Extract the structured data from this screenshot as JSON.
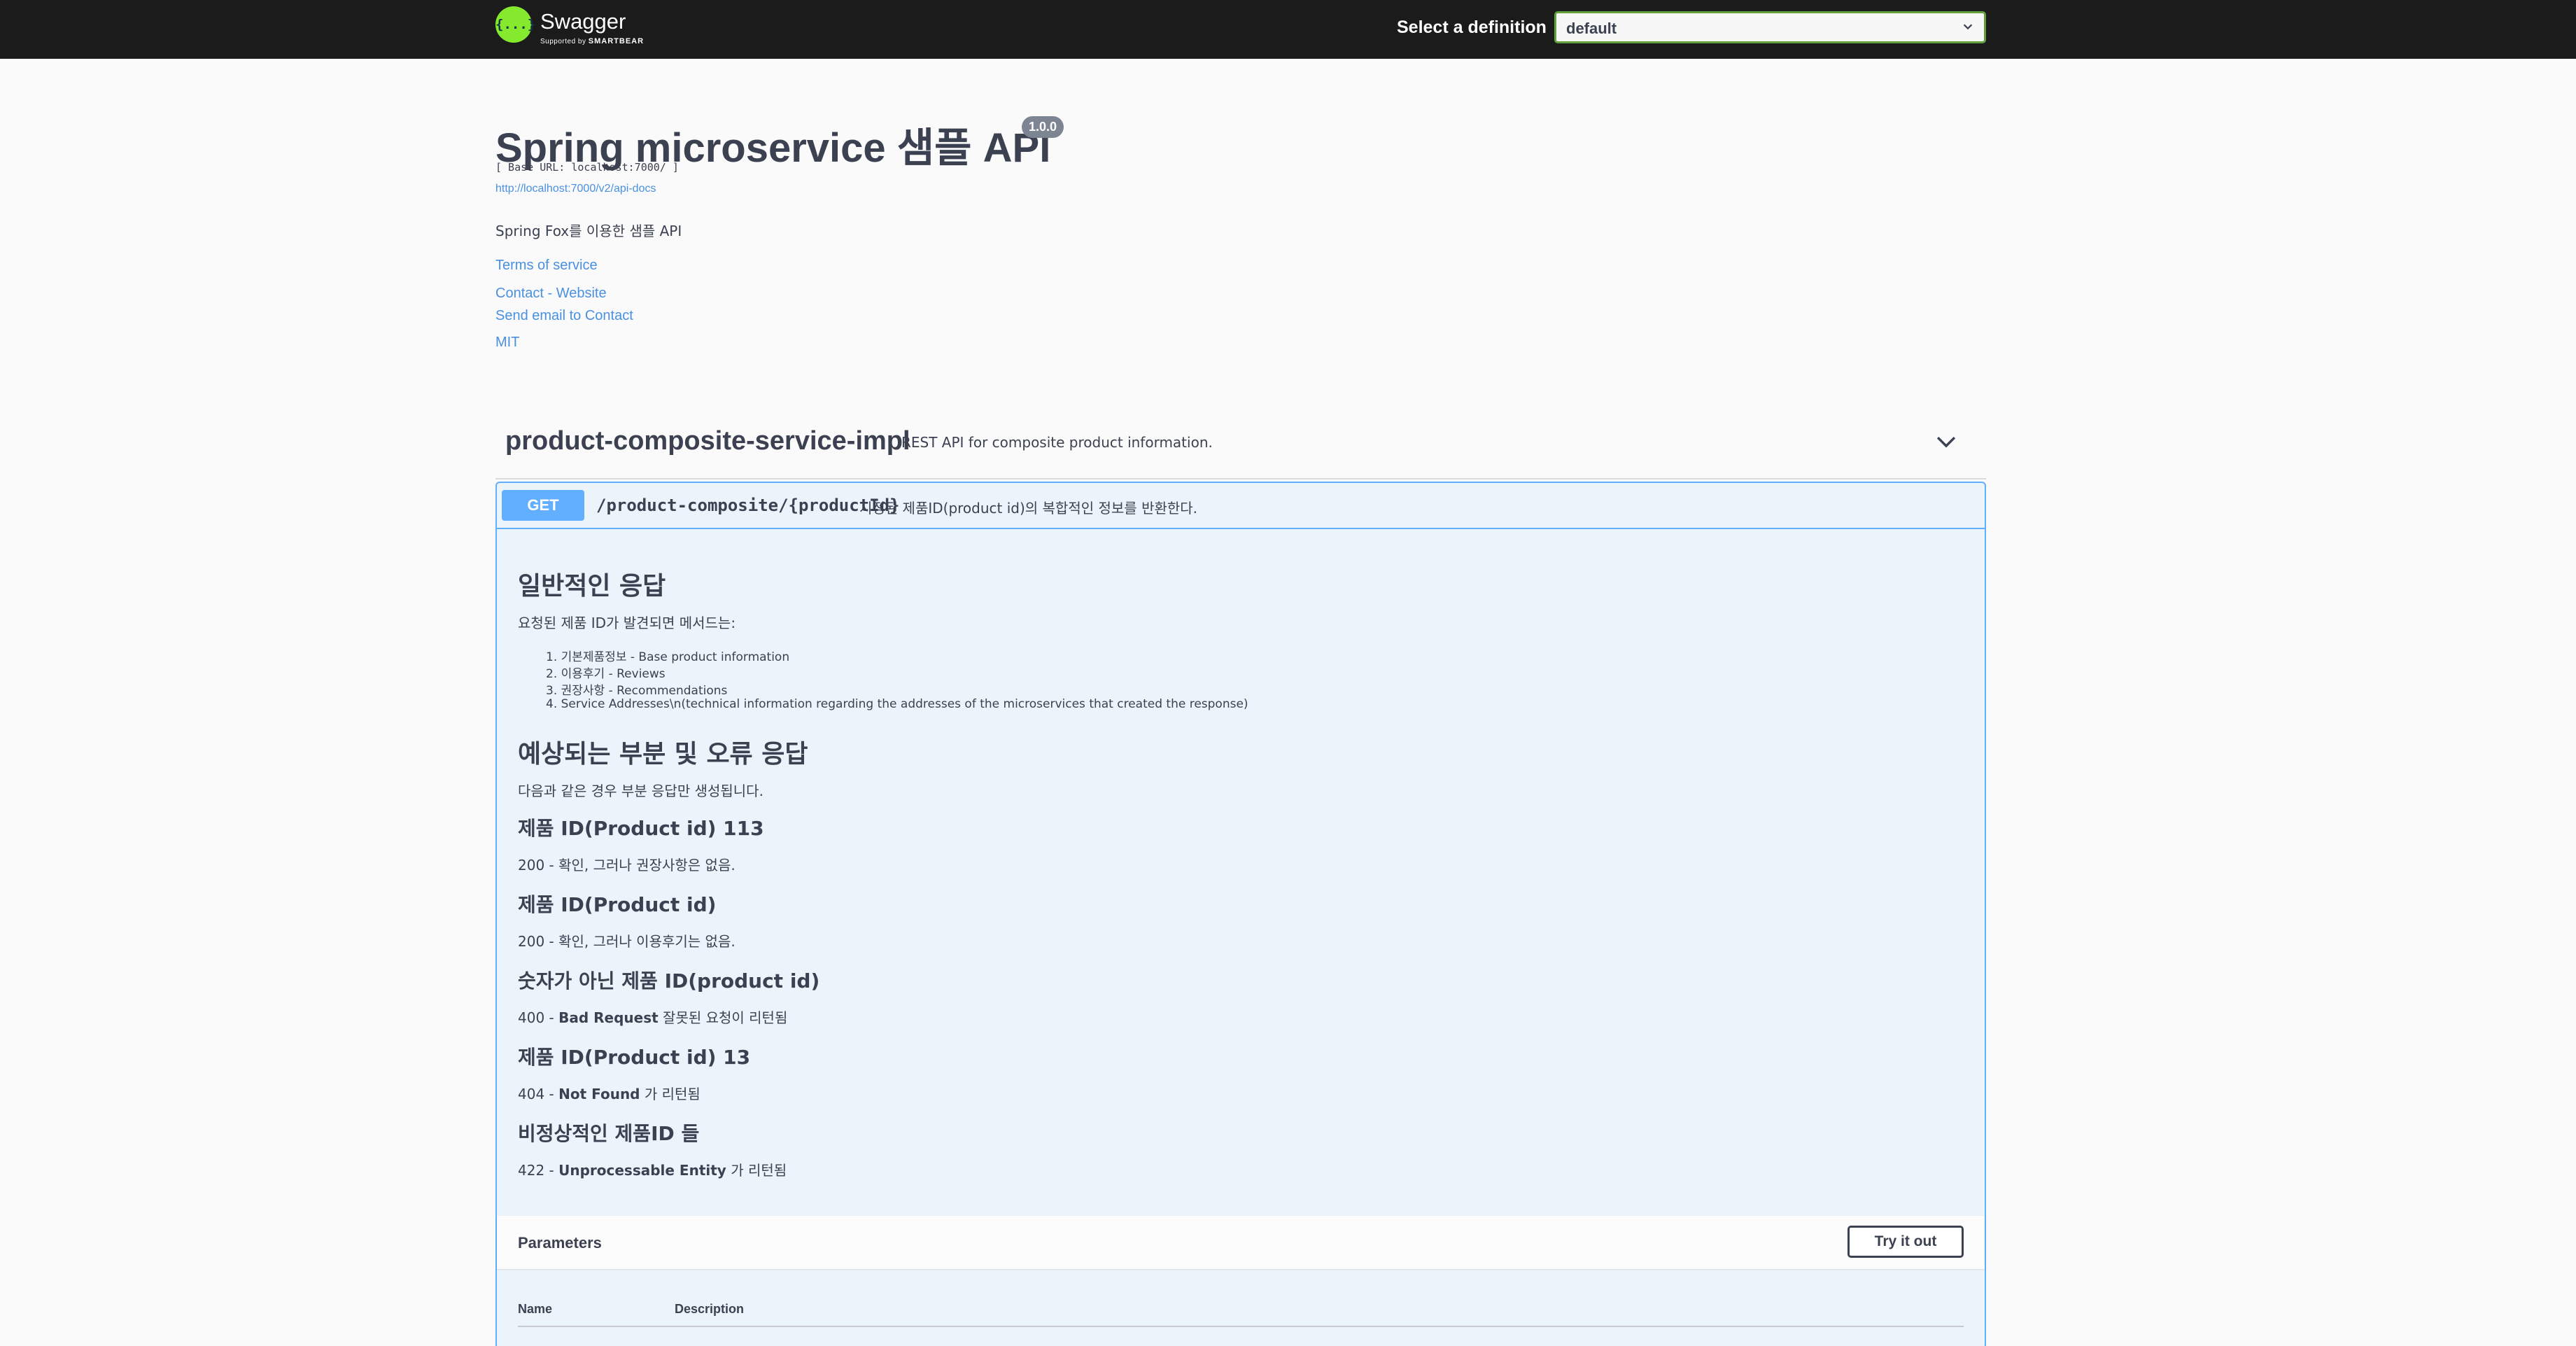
{
  "topbar": {
    "logo_icon_text": "{...}",
    "logo_name": "Swagger",
    "logo_sub_prefix": "Supported by",
    "logo_sub_brand": "SMARTBEAR",
    "select_label": "Select a definition",
    "select_value": "default"
  },
  "info": {
    "title": "Spring microservice 샘플 API",
    "version": "1.0.0",
    "base_url": "[ Base URL: localhost:7000/ ]",
    "spec_link": "http://localhost:7000/v2/api-docs",
    "description": "Spring Fox를 이용한 샘플 API",
    "terms": "Terms of service",
    "contact_website": "Contact - Website",
    "contact_email": "Send email to Contact",
    "license": "MIT"
  },
  "tag": {
    "name": "product-composite-service-impl",
    "description": "REST API for composite product information."
  },
  "operation": {
    "method": "GET",
    "path": "/product-composite/{productId}",
    "summary": "지정된 제품ID(product id)의 복합적인 정보를 반환한다.",
    "normal_heading": "일반적인 응답",
    "normal_intro": "요청된 제품 ID가 발견되면 메서드는:",
    "normal_items": [
      "1. 기본제품정보 - Base product information",
      "2. 이용후기 - Reviews",
      "3. 권장사항 - Recommendations",
      "4. Service Addresses\\n(technical information regarding the addresses of the microservices that created the response)"
    ],
    "error_heading": "예상되는 부분 및 오류 응답",
    "error_intro": "다음과 같은 경우 부분 응답만 생성됩니다.",
    "cases": [
      {
        "heading": "제품 ID(Product id) 113",
        "code": "200 - ",
        "bold": "",
        "text": "확인, 그러나 권장사항은 없음."
      },
      {
        "heading": "제품 ID(Product id)",
        "code": "200 - ",
        "bold": "",
        "text": "확인, 그러나 이용후기는 없음."
      },
      {
        "heading": "숫자가 아닌 제품 ID(product id)",
        "code": "400 - ",
        "bold": "Bad Request",
        "text": " 잘못된 요청이 리턴됨"
      },
      {
        "heading": "제품 ID(Product id) 13",
        "code": "404 - ",
        "bold": "Not Found",
        "text": " 가 리턴됨"
      },
      {
        "heading": "비정상적인 제품ID 들",
        "code": "422 - ",
        "bold": "Unprocessable Entity",
        "text": " 가 리턴됨"
      }
    ],
    "parameters_title": "Parameters",
    "try_it_out": "Try it out",
    "col_name": "Name",
    "col_description": "Description"
  },
  "colors": {
    "topbar_bg": "#1b1b1b",
    "get_method": "#61affe",
    "opblock_bg": "#ebf3fb",
    "link": "#4990e2",
    "select_border": "#62a03f"
  }
}
